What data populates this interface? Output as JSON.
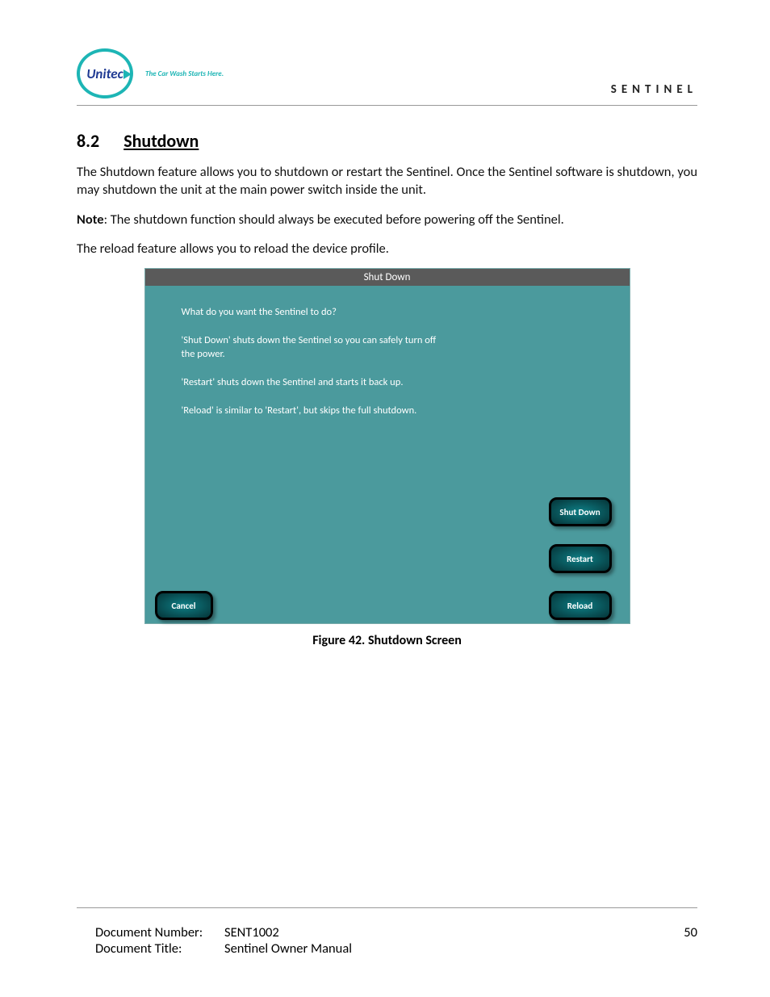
{
  "header": {
    "logo_text": "Unitec",
    "tagline": "The Car Wash Starts Here.",
    "product": "SENTINEL"
  },
  "section": {
    "number": "8.2",
    "title": "Shutdown"
  },
  "paragraphs": {
    "p1": "The Shutdown feature allows you to shutdown or restart the Sentinel. Once the Sentinel software is shutdown, you may shutdown the unit at the main power switch inside the unit.",
    "note_label": "Note",
    "note_text": ": The shutdown function should always be executed before powering off the Sentinel.",
    "p2": "The reload feature allows you to reload the device profile."
  },
  "dialog": {
    "title": "Shut Down",
    "q": "What do you want the Sentinel to do?",
    "l1": "'Shut Down' shuts down the Sentinel so you can safely turn off the power.",
    "l2": "'Restart' shuts down the Sentinel and starts it back up.",
    "l3": "'Reload' is similar to 'Restart', but skips the full shutdown.",
    "btn_shutdown": "Shut Down",
    "btn_restart": "Restart",
    "btn_reload": "Reload",
    "btn_cancel": "Cancel"
  },
  "figure_caption": "Figure 42. Shutdown Screen",
  "footer": {
    "doc_num_label": "Document Number:",
    "doc_num": "SENT1002",
    "doc_title_label": "Document Title:",
    "doc_title": "Sentinel Owner Manual",
    "page": "50"
  }
}
